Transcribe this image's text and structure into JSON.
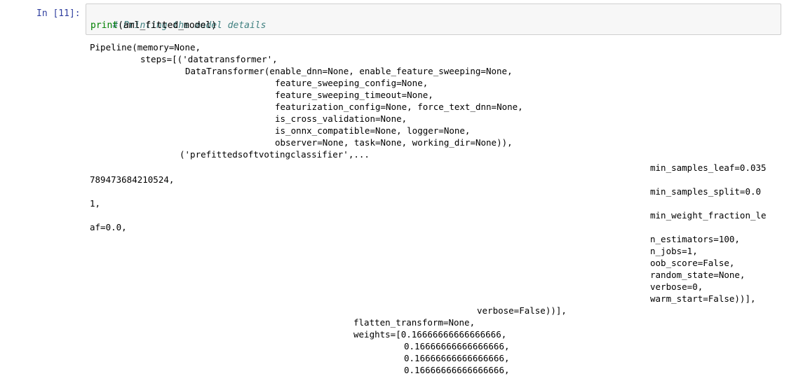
{
  "cell": {
    "prompt": "In [11]:",
    "comment": "# Printing the model details",
    "code_func": "print",
    "code_args": "(aml_fitted_model)"
  },
  "output": {
    "lines": [
      "Pipeline(memory=None,",
      "steps=[('datatransformer',",
      "DataTransformer(enable_dnn=None, enable_feature_sweeping=None,",
      "feature_sweeping_config=None,",
      "feature_sweeping_timeout=None,",
      "featurization_config=None, force_text_dnn=None,",
      "is_cross_validation=None,",
      "is_onnx_compatible=None, logger=None,",
      "observer=None, task=None, working_dir=None)),",
      "('prefittedsoftvotingclassifier',...",
      "min_samples_leaf=0.035",
      "789473684210524,",
      "min_samples_split=0.0",
      "1,",
      "min_weight_fraction_le",
      "af=0.0,",
      "n_estimators=100,",
      "n_jobs=1,",
      "oob_score=False,",
      "random_state=None,",
      "verbose=0,",
      "warm_start=False))],",
      "verbose=False))],",
      "flatten_transform=None,",
      "weights=[0.16666666666666666,",
      "0.16666666666666666,",
      "0.16666666666666666,",
      "0.16666666666666666,"
    ]
  }
}
